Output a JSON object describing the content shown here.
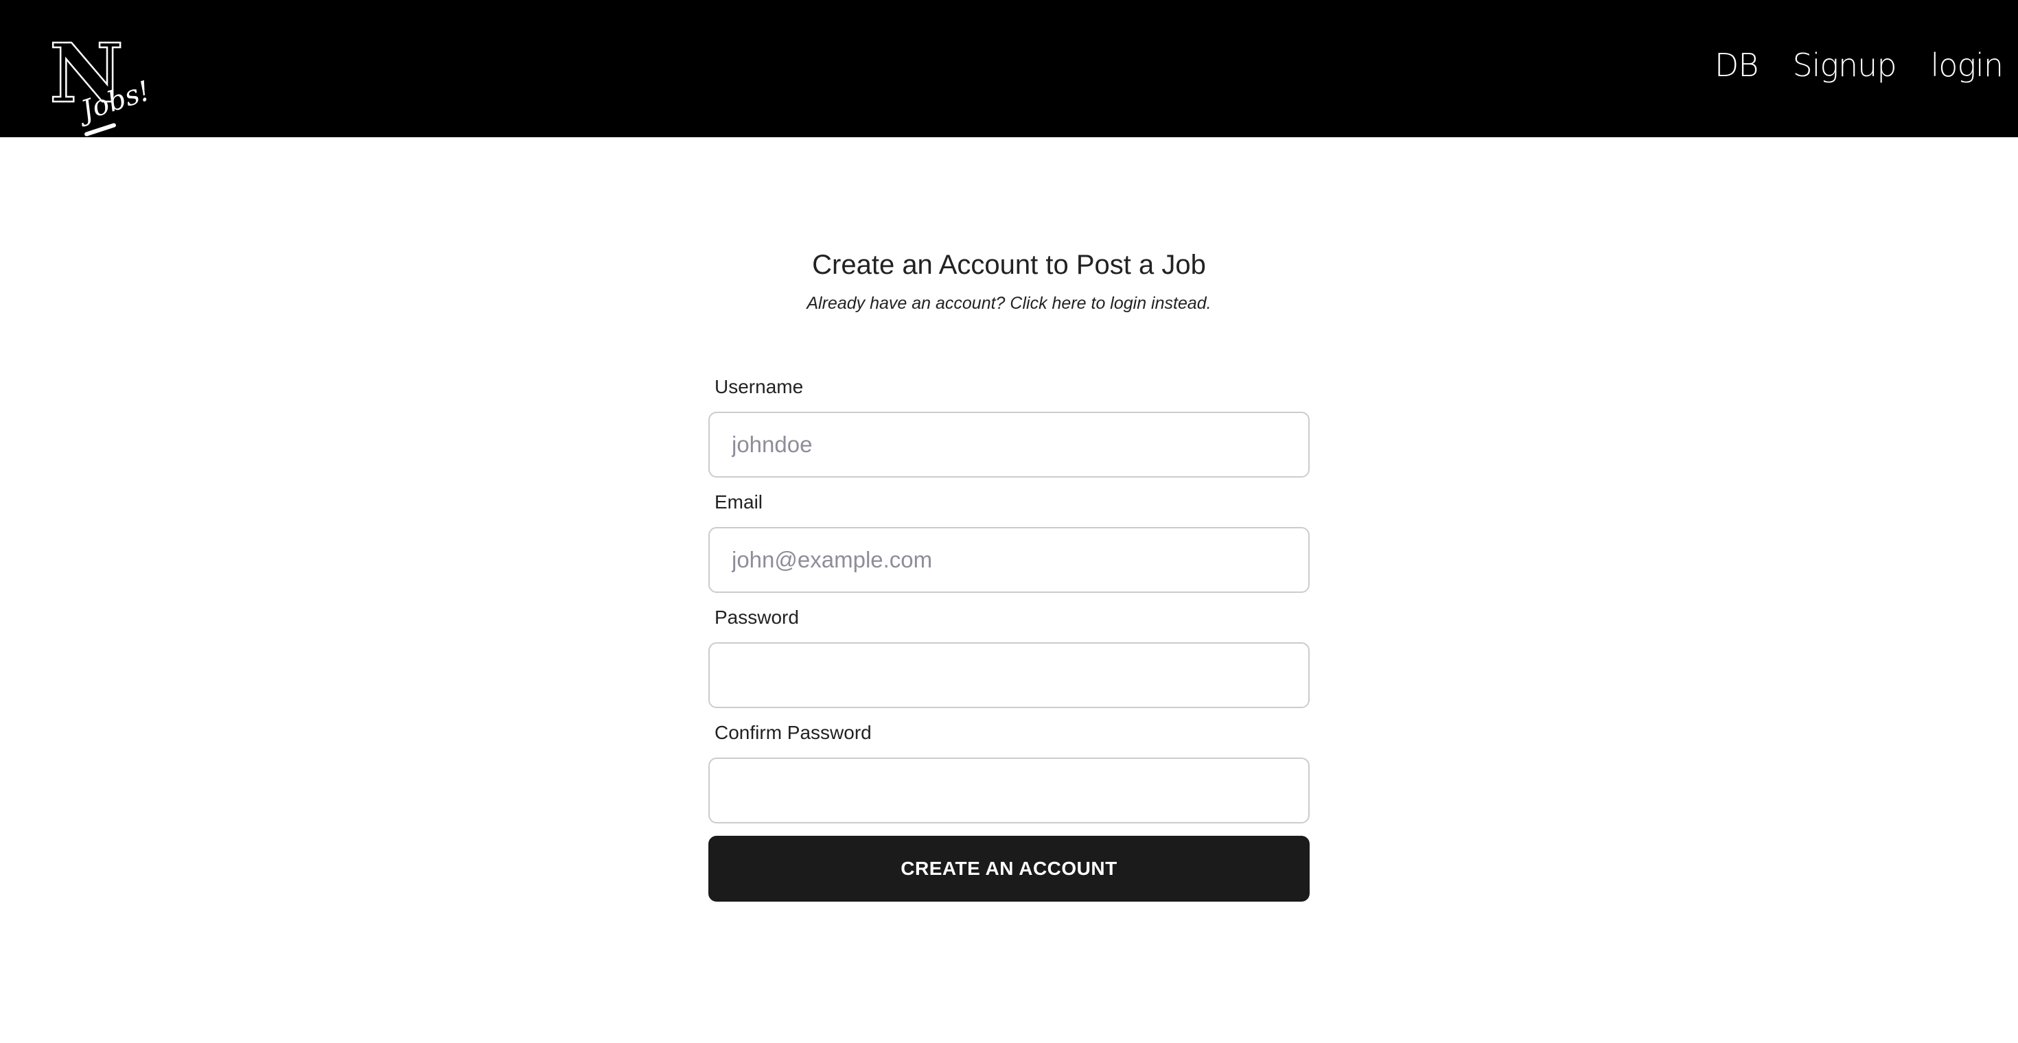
{
  "header": {
    "logo": {
      "letter": "N",
      "text": "Jobs!"
    },
    "nav": [
      {
        "label": "DB"
      },
      {
        "label": "Signup"
      },
      {
        "label": "login"
      }
    ],
    "background_color": "#000000"
  },
  "main": {
    "title": "Create an Account to Post a Job",
    "subtitle": "Already have an account? Click here to login instead.",
    "form": {
      "username": {
        "label": "Username",
        "placeholder": "johndoe",
        "value": ""
      },
      "email": {
        "label": "Email",
        "placeholder": "john@example.com",
        "value": ""
      },
      "password": {
        "label": "Password",
        "placeholder": "",
        "value": ""
      },
      "confirm_password": {
        "label": "Confirm Password",
        "placeholder": "",
        "value": ""
      },
      "submit_label": "CREATE AN ACCOUNT",
      "submit_color": "#1b1b1b"
    }
  }
}
